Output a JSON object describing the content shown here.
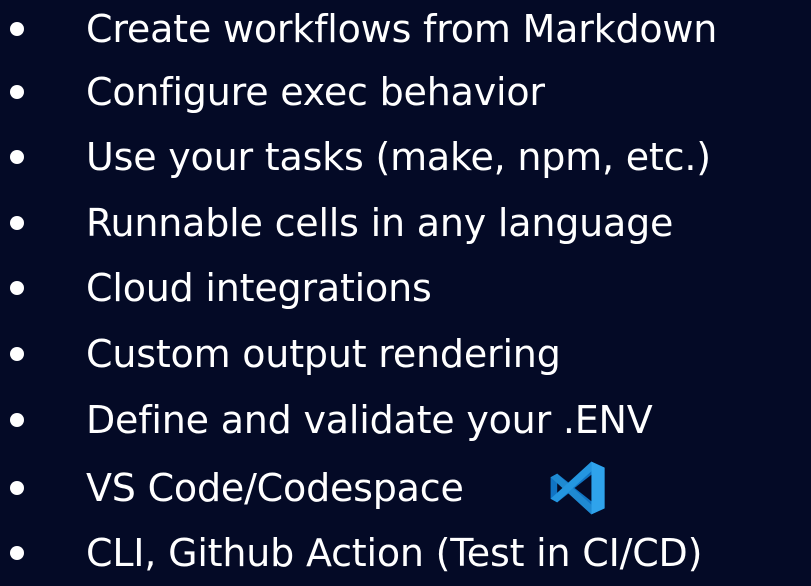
{
  "colors": {
    "background": "#040a26",
    "text": "#ffffff",
    "vscode_blue_light": "#2fa3ec",
    "vscode_blue_dark": "#1074c4"
  },
  "features": [
    {
      "label": "Create workflows from Markdown"
    },
    {
      "label": "Configure exec behavior"
    },
    {
      "label": "Use your tasks (make, npm, etc.)"
    },
    {
      "label": "Runnable cells in any language"
    },
    {
      "label": "Cloud integrations"
    },
    {
      "label": "Custom output rendering"
    },
    {
      "label": "Define and validate your .ENV"
    },
    {
      "label": "VS Code/Codespace",
      "icon": "vscode-logo-icon"
    },
    {
      "label": "CLI, Github Action (Test in CI/CD)"
    }
  ]
}
